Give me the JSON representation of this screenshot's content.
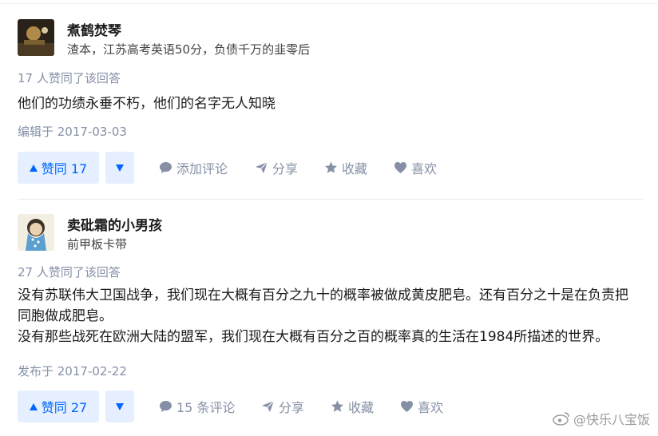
{
  "answers": [
    {
      "author_name": "煮鹤焚琴",
      "author_bio": "渣本，江苏高考英语50分，负债千万的韭零后",
      "votes_text": "17 人赞同了该回答",
      "content": [
        "他们的功绩永垂不朽，他们的名字无人知晓"
      ],
      "date_text": "编辑于 2017-03-03",
      "vote_up_label": "赞同 17",
      "comment_label": "添加评论",
      "share_label": "分享",
      "collect_label": "收藏",
      "like_label": "喜欢"
    },
    {
      "author_name": "卖砒霜的小男孩",
      "author_bio": "前甲板卡带",
      "votes_text": "27 人赞同了该回答",
      "content": [
        "没有苏联伟大卫国战争，我们现在大概有百分之九十的概率被做成黄皮肥皂。还有百分之十是在负责把同胞做成肥皂。",
        "没有那些战死在欧洲大陆的盟军，我们现在大概有百分之百的概率真的生活在1984所描述的世界。"
      ],
      "date_text": "发布于 2017-02-22",
      "vote_up_label": "赞同 27",
      "comment_label": "15 条评论",
      "share_label": "分享",
      "collect_label": "收藏",
      "like_label": "喜欢"
    }
  ],
  "watermark": "@快乐八宝饭",
  "colors": {
    "accent": "#0066ff",
    "accent_bg": "#e5efff",
    "muted": "#8590a6"
  }
}
